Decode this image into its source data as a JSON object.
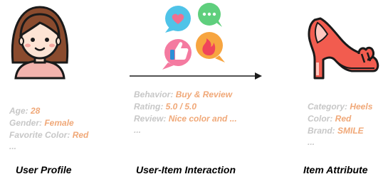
{
  "user": {
    "attributes": [
      {
        "key": "Age: ",
        "value": "28"
      },
      {
        "key": "Gender: ",
        "value": "Female"
      },
      {
        "key": "Favorite Color: ",
        "value": "Red"
      }
    ],
    "ellipsis": "...",
    "caption": "User Profile"
  },
  "interaction": {
    "attributes": [
      {
        "key": "Behavior: ",
        "value": "Buy & Review"
      },
      {
        "key": "Rating: ",
        "value": "5.0 / 5.0"
      },
      {
        "key": "Review: ",
        "value": "Nice color and ..."
      }
    ],
    "ellipsis": "...",
    "caption": "User-Item Interaction"
  },
  "item": {
    "attributes": [
      {
        "key": "Category: ",
        "value": "Heels"
      },
      {
        "key": "Color: ",
        "value": "Red"
      },
      {
        "key": "Brand: ",
        "value": "SMILE"
      }
    ],
    "ellipsis": "...",
    "caption": "Item Attribute"
  },
  "icons": [
    "user-avatar-icon",
    "social-bubbles-icon",
    "high-heel-icon",
    "arrow-right-icon"
  ],
  "colors": {
    "key_text": "#c7c7c7",
    "value_text": "#f0a878",
    "heel_red": "#f25c4f"
  }
}
